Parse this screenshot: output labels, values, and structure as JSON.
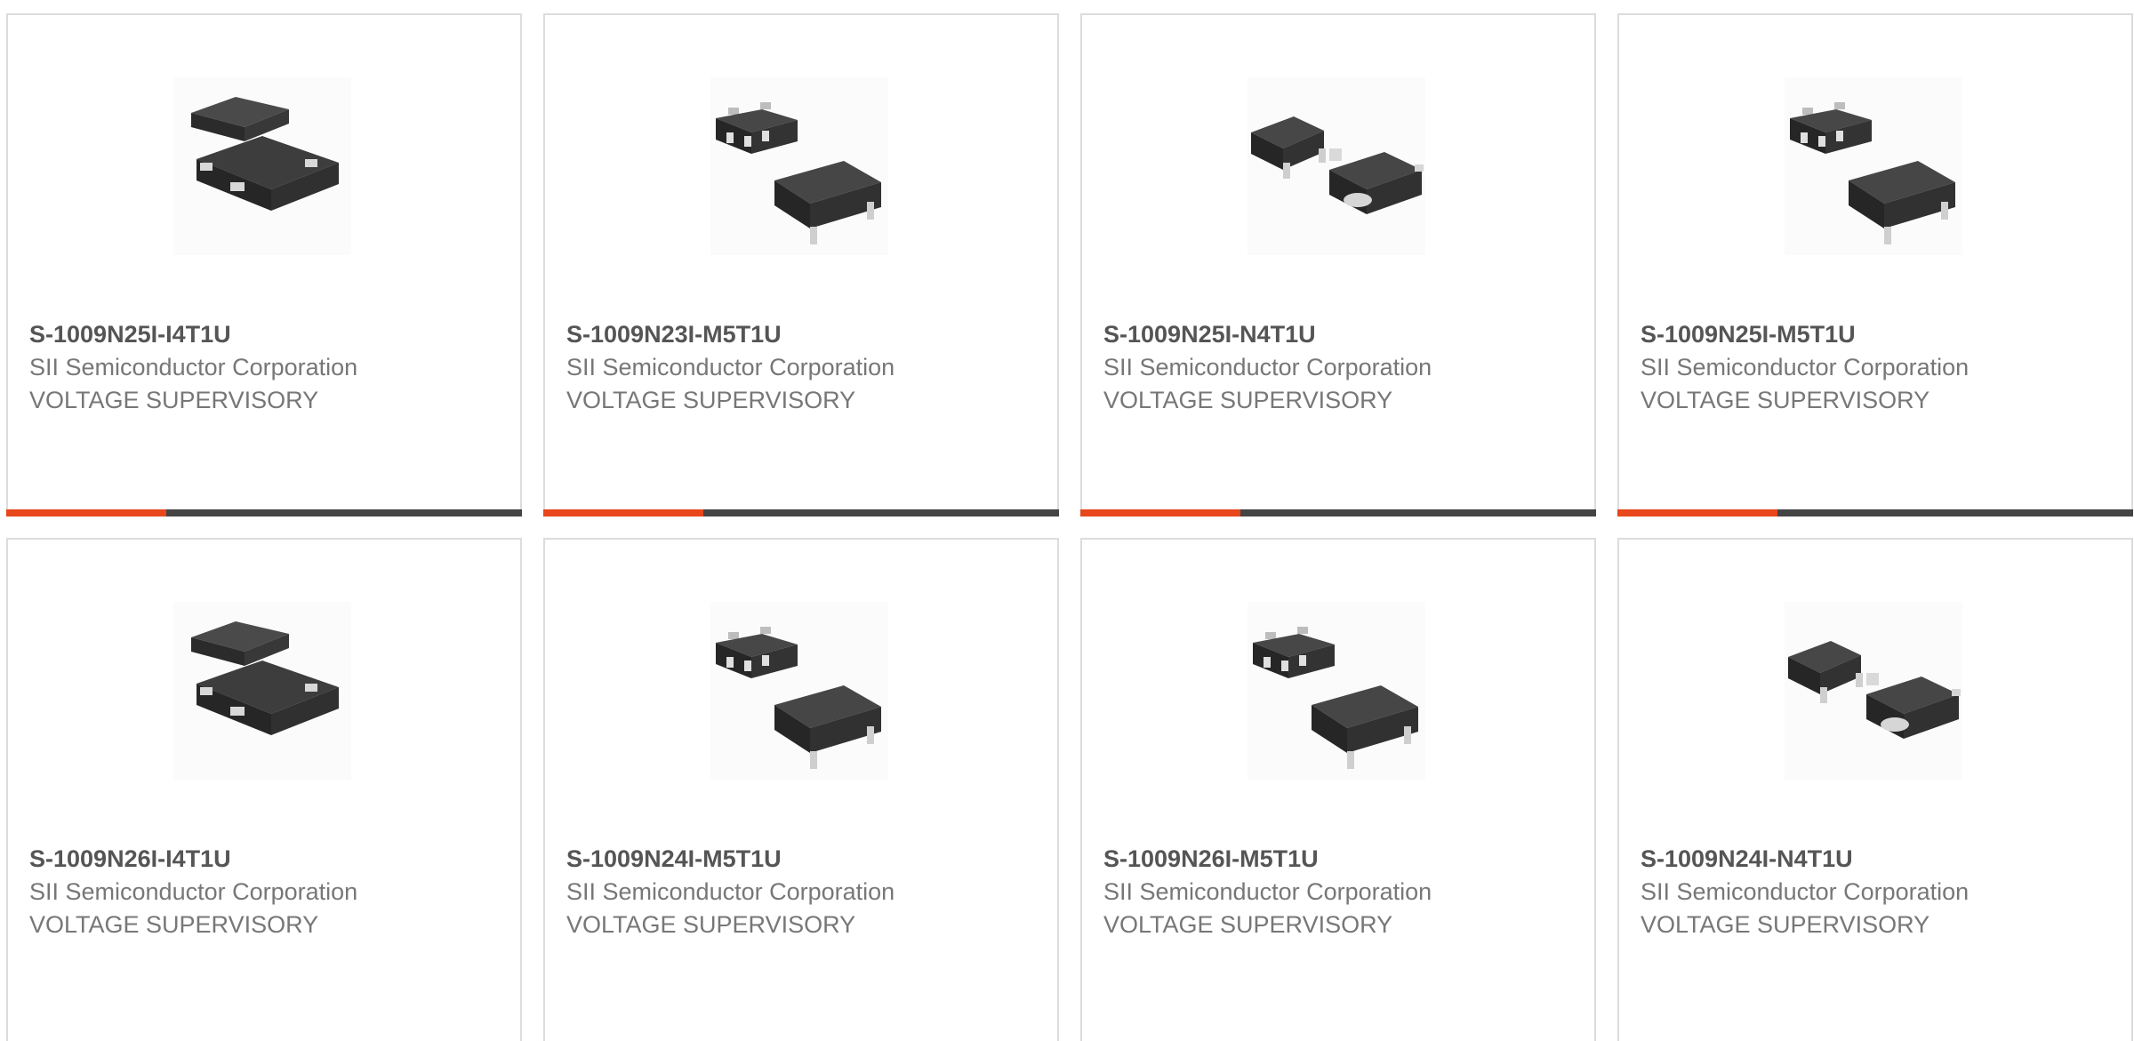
{
  "colors": {
    "accent": "#e8461b",
    "bar": "#444444",
    "card_border": "#dcdcdc",
    "part_text": "#555555",
    "meta_text": "#777777"
  },
  "cards": [
    {
      "part": "S-1009N25I-I4T1U",
      "manufacturer": "SII Semiconductor Corporation",
      "description": "VOLTAGE SUPERVISORY",
      "image_icon": "snt-4a-package-icon",
      "progress": 0.31
    },
    {
      "part": "S-1009N23I-M5T1U",
      "manufacturer": "SII Semiconductor Corporation",
      "description": "VOLTAGE SUPERVISORY",
      "image_icon": "sot-23-5-package-icon",
      "progress": 0.31
    },
    {
      "part": "S-1009N25I-N4T1U",
      "manufacturer": "SII Semiconductor Corporation",
      "description": "VOLTAGE SUPERVISORY",
      "image_icon": "sc-82ab-package-icon",
      "progress": 0.31
    },
    {
      "part": "S-1009N25I-M5T1U",
      "manufacturer": "SII Semiconductor Corporation",
      "description": "VOLTAGE SUPERVISORY",
      "image_icon": "sot-23-5-package-icon",
      "progress": 0.31
    },
    {
      "part": "S-1009N26I-I4T1U",
      "manufacturer": "SII Semiconductor Corporation",
      "description": "VOLTAGE SUPERVISORY",
      "image_icon": "snt-4a-package-icon",
      "progress": 0
    },
    {
      "part": "S-1009N24I-M5T1U",
      "manufacturer": "SII Semiconductor Corporation",
      "description": "VOLTAGE SUPERVISORY",
      "image_icon": "sot-23-5-package-icon",
      "progress": 0
    },
    {
      "part": "S-1009N26I-M5T1U",
      "manufacturer": "SII Semiconductor Corporation",
      "description": "VOLTAGE SUPERVISORY",
      "image_icon": "sot-23-5-package-icon",
      "progress": 0
    },
    {
      "part": "S-1009N24I-N4T1U",
      "manufacturer": "SII Semiconductor Corporation",
      "description": "VOLTAGE SUPERVISORY",
      "image_icon": "sc-82ab-package-icon",
      "progress": 0
    }
  ]
}
